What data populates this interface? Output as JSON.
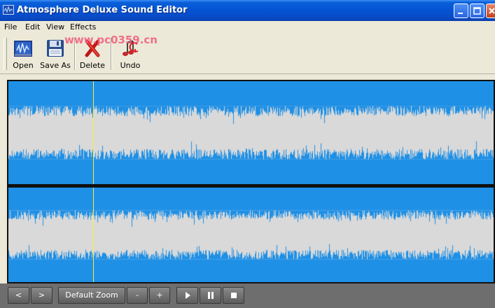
{
  "window": {
    "title": "Atmosphere Deluxe Sound Editor"
  },
  "menu": {
    "items": [
      "File",
      "Edit",
      "View",
      "Effects"
    ]
  },
  "watermark": "www.pc0359.cn",
  "toolbar": {
    "open_label": "Open",
    "save_as_label": "Save As",
    "delete_label": "Delete",
    "undo_label": "Undo"
  },
  "controls": {
    "prev_label": "<",
    "next_label": ">",
    "zoom_label": "Default Zoom",
    "zoom_out_label": "-",
    "zoom_in_label": "+",
    "play_icon": "play-icon",
    "pause_icon": "pause-icon",
    "stop_icon": "stop-icon"
  },
  "colors": {
    "waveform": "#1e90e6",
    "cursor": "#ffeb3b",
    "channel_background": "#d9d9d9"
  },
  "playback": {
    "cursor_position_fraction": 0.175
  }
}
